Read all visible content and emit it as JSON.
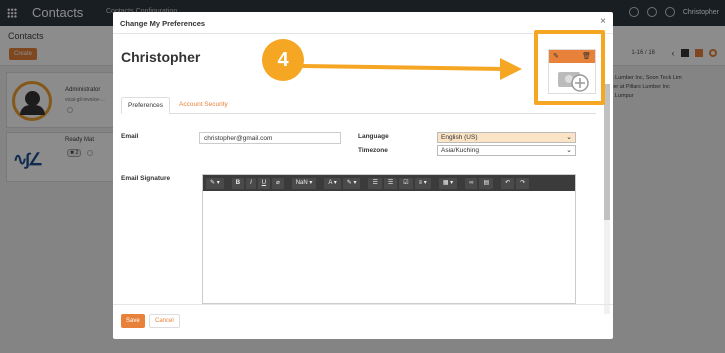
{
  "app": {
    "brand": "Contacts",
    "top_menu": "Contacts   Configuration",
    "user_name": "Christopher"
  },
  "control_panel": {
    "breadcrumb": "Contacts",
    "create_label": "Create",
    "pager": "1-16 / 16"
  },
  "background_cards": [
    {
      "title": "Administrator",
      "subtitle": "vicai-gil-invoice-..."
    },
    {
      "title": "Ready Mat",
      "badge": "✖ 2"
    }
  ],
  "right_card_lines": [
    "ers Lumber Inc, Soon Teck Lim",
    "ecter at Pillars Lumber Inc",
    "ala Lumpur"
  ],
  "modal": {
    "title": "Change My Preferences",
    "close": "×",
    "user_name": "Christopher",
    "tabs": [
      {
        "label": "Preferences",
        "active": true
      },
      {
        "label": "Account Security",
        "active": false
      }
    ],
    "fields": {
      "email_label": "Email",
      "email_value": "christopher@gmail.com",
      "language_label": "Language",
      "language_value": "English (US)",
      "timezone_label": "Timezone",
      "timezone_value": "Asia/Kuching",
      "signature_label": "Email Signature"
    },
    "editor_toolbar": [
      "✎ ▾",
      "B",
      "I",
      "U",
      "⌀",
      "NaN ▾",
      "A ▾",
      "✎ ▾",
      "☰",
      "☰",
      "☑",
      "≡ ▾",
      "▦ ▾",
      "∞",
      "▤",
      "↶",
      "↷"
    ],
    "save_label": "Save",
    "cancel_label": "Cancel",
    "image_edit_icon": "pencil-icon",
    "image_delete_icon": "trash-icon"
  },
  "annotation": {
    "step_number": "4",
    "color": "#f5a623"
  },
  "colors": {
    "accent": "#e8823a",
    "topbar": "#2f3740"
  }
}
